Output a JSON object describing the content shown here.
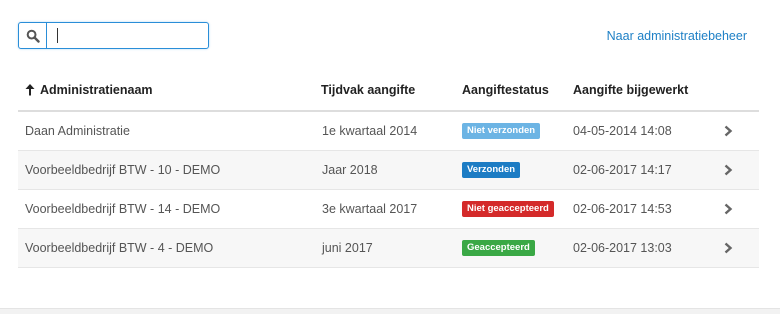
{
  "search": {
    "placeholder": "",
    "value": ""
  },
  "header": {
    "admin_link": "Naar administratiebeheer"
  },
  "table": {
    "columns": [
      "Administratienaam",
      "Tijdvak aangifte",
      "Aangiftestatus",
      "Aangifte bijgewerkt"
    ],
    "sort_column": "Administratienaam",
    "rows": [
      {
        "name": "Daan Administratie",
        "period": "1e kwartaal 2014",
        "status": "Niet verzonden",
        "status_color": "#6cb4e4",
        "updated": "04-05-2014 14:08"
      },
      {
        "name": "Voorbeeldbedrijf BTW - 10 - DEMO",
        "period": "Jaar 2018",
        "status": "Verzonden",
        "status_color": "#1c7cc4",
        "updated": "02-06-2017 14:17"
      },
      {
        "name": "Voorbeeldbedrijf BTW - 14 - DEMO",
        "period": "3e kwartaal 2017",
        "status": "Niet geaccepteerd",
        "status_color": "#d42a2a",
        "updated": "02-06-2017 14:53"
      },
      {
        "name": "Voorbeeldbedrijf BTW - 4 - DEMO",
        "period": "juni 2017",
        "status": "Geaccepteerd",
        "status_color": "#3aa845",
        "updated": "02-06-2017 13:03"
      }
    ]
  },
  "icons": {
    "search": "search-icon",
    "sort": "arrow-up-icon",
    "row_action": "chevron-right-icon"
  },
  "colors": {
    "accent": "#1e80c6",
    "focus_border": "#2a8ed8"
  }
}
